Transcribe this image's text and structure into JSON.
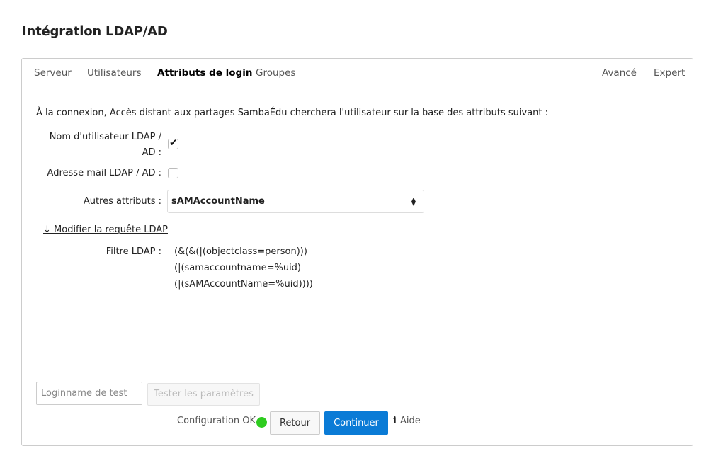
{
  "page": {
    "title": "Intégration LDAP/AD"
  },
  "tabs": {
    "server": "Serveur",
    "users": "Utilisateurs",
    "login_attributes": "Attributs de login",
    "groups": "Groupes",
    "advanced": "Avancé",
    "expert": "Expert",
    "active": "login_attributes"
  },
  "form": {
    "intro": "À la connexion, Accès distant aux partages SambaÉdu cherchera l'utilisateur sur la base des attributs suivant :",
    "ldap_username_label_line1": "Nom d'utilisateur LDAP /",
    "ldap_username_label_line2": "AD :",
    "ldap_username_checked": true,
    "ldap_mail_label": "Adresse mail LDAP / AD :",
    "ldap_mail_checked": false,
    "other_attributes_label": "Autres attributs :",
    "other_attributes_value": "sAMAccountName",
    "modify_query_link": "↓ Modifier la requête LDAP",
    "filter_label": "Filtre LDAP :",
    "filter_lines": [
      "(&(&(|(objectclass=person)))",
      "(|(samaccountname=%uid)",
      "(|(sAMAccountName=%uid))))"
    ]
  },
  "footer": {
    "test_placeholder": "Loginname de test",
    "test_button": "Tester les paramètres",
    "status_text": "Configuration OK",
    "status_color": "#2ecc1f",
    "back_button": "Retour",
    "continue_button": "Continuer",
    "continue_color": "#0a7bd6",
    "help_icon": "i",
    "help_label": "Aide"
  }
}
